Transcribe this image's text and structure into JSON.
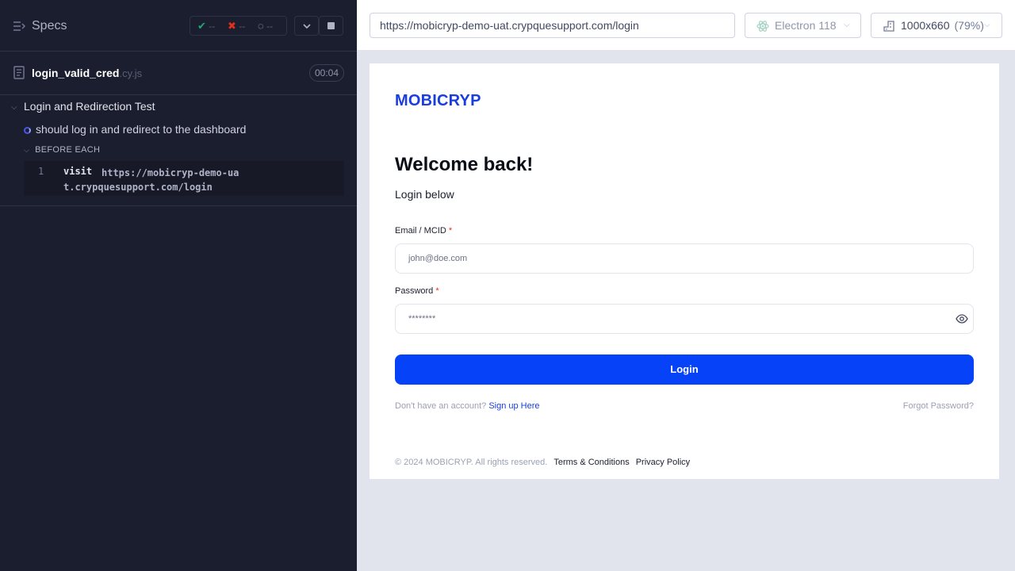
{
  "runner": {
    "specs_label": "Specs",
    "stats": {
      "passed": "--",
      "failed": "--",
      "pending": "--"
    },
    "spec": {
      "name": "login_valid_cred",
      "ext": ".cy.js",
      "duration": "00:04"
    },
    "suite_title": "Login and Redirection Test",
    "test_title": "should log in and redirect to the dashboard",
    "hook_label": "BEFORE EACH",
    "command": {
      "number": "1",
      "name": "visit",
      "arg": "https://mobicryp-demo-uat.crypquesupport.com/login"
    }
  },
  "browser_bar": {
    "url": "https://mobicryp-demo-uat.crypquesupport.com/login",
    "browser": "Electron 118",
    "viewport": "1000x660",
    "scale": "(79%)"
  },
  "app": {
    "logo": "MOBICRYP",
    "heading": "Welcome back!",
    "subheading": "Login below",
    "email_label": "Email / MCID",
    "email_placeholder": "john@doe.com",
    "password_label": "Password",
    "password_value": "********",
    "required_mark": "*",
    "login_button": "Login",
    "no_account_text": "Don't have an account?",
    "signup_link": "Sign up Here",
    "forgot_link": "Forgot Password?",
    "copyright": "© 2024 MOBICRYP. All rights reserved.",
    "terms_link": "Terms & Conditions",
    "privacy_link": "Privacy Policy"
  },
  "icons": [
    "specs-icon",
    "check-icon",
    "x-icon",
    "spinner-icon",
    "chevron-down-icon",
    "stop-icon",
    "file-icon",
    "electron-icon",
    "ruler-icon",
    "eye-icon"
  ],
  "colors": {
    "runner_bg": "#1b1e2e",
    "brand": "#1a3de0",
    "login_button": "#0642f7",
    "required": "#e0311c",
    "pass": "#1fa971",
    "fail": "#e0311c"
  }
}
